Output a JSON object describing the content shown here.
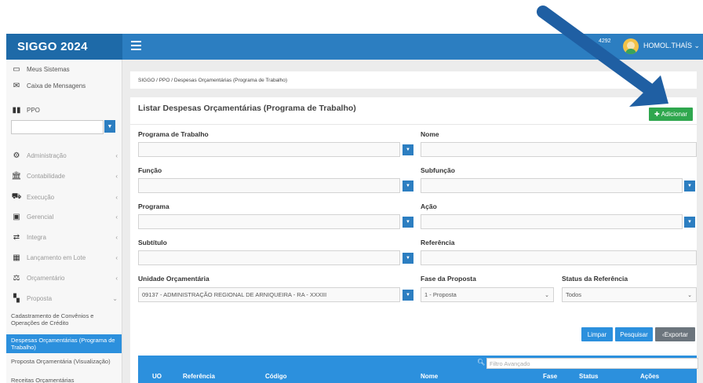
{
  "header": {
    "brand": "SIGGO 2024",
    "badge": "4292",
    "user_name": "HOMOL.THAÍS",
    "user_chevron": "⌄"
  },
  "sidebar": {
    "top_items": [
      {
        "label": "Meus Sistemas",
        "icon": "monitor-icon"
      },
      {
        "label": "Caixa de Mensagens",
        "icon": "envelope-icon"
      }
    ],
    "ppo_label": "PPO",
    "ppo_value": "",
    "modules": [
      {
        "label": "Administração",
        "icon": "gear-icon"
      },
      {
        "label": "Contabilidade",
        "icon": "bank-icon"
      },
      {
        "label": "Execução",
        "icon": "execution-icon"
      },
      {
        "label": "Gerencial",
        "icon": "report-icon"
      },
      {
        "label": "Integra",
        "icon": "integration-icon"
      },
      {
        "label": "Lançamento em Lote",
        "icon": "batch-icon"
      },
      {
        "label": "Orçamentário",
        "icon": "budget-icon"
      },
      {
        "label": "Proposta",
        "icon": "proposal-icon"
      }
    ],
    "submenu": [
      {
        "label": "Cadastramento de Convênios e Operações de Crédito"
      },
      {
        "label": "Despesas Orçamentárias (Programa de Trabalho)"
      },
      {
        "label": "Proposta Orçamentária (Visualização)"
      },
      {
        "label": "Receitas Orçamentárias"
      }
    ]
  },
  "breadcrumb": "SIGGO  /  PPO  /  Despesas Orçamentárias (Programa de Trabalho)",
  "page": {
    "title": "Listar Despesas Orçamentárias (Programa de Trabalho)",
    "add_label": "Adicionar"
  },
  "form": {
    "programa_trabalho": "Programa de Trabalho",
    "nome": "Nome",
    "funcao": "Função",
    "subfuncao": "Subfunção",
    "programa": "Programa",
    "acao": "Ação",
    "subtitulo": "Subtítulo",
    "referencia": "Referência",
    "unidade": "Unidade Orçamentária",
    "unidade_value": "09137 - ADMINISTRAÇÃO REGIONAL DE ARNIQUEIRA - RA - XXXIII",
    "fase": "Fase da Proposta",
    "fase_value": "1 - Proposta",
    "status": "Status da Referência",
    "status_value": "Todos"
  },
  "buttons": {
    "limpar": "Limpar",
    "pesquisar": "Pesquisar",
    "exportar": "Exportar"
  },
  "table": {
    "filter_placeholder": "Filtro Avançado",
    "columns": [
      "UO",
      "Referência",
      "Código",
      "Nome",
      "Fase",
      "Status",
      "Ações"
    ]
  },
  "colors": {
    "topbar": "#2c7ec1",
    "brand": "#1e6aa8",
    "accent": "#2c90dd",
    "add": "#2fa74e",
    "export": "#6c757d",
    "arrow": "#1f5fa3"
  }
}
